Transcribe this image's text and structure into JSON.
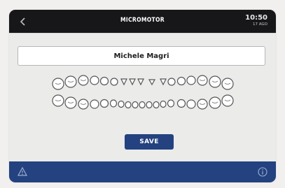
{
  "header": {
    "title": "MICROMOTOR",
    "time": "10:50",
    "date": "17 AGO"
  },
  "patient": {
    "name": "Michele Magri"
  },
  "actions": {
    "save_label": "SAVE"
  },
  "icons": {
    "back": "chevron-left-icon",
    "warning": "warning-triangle-icon",
    "info": "info-circle-icon"
  },
  "colors": {
    "topbar": "#17171a",
    "accent": "#23427f",
    "background": "#ebebea"
  }
}
